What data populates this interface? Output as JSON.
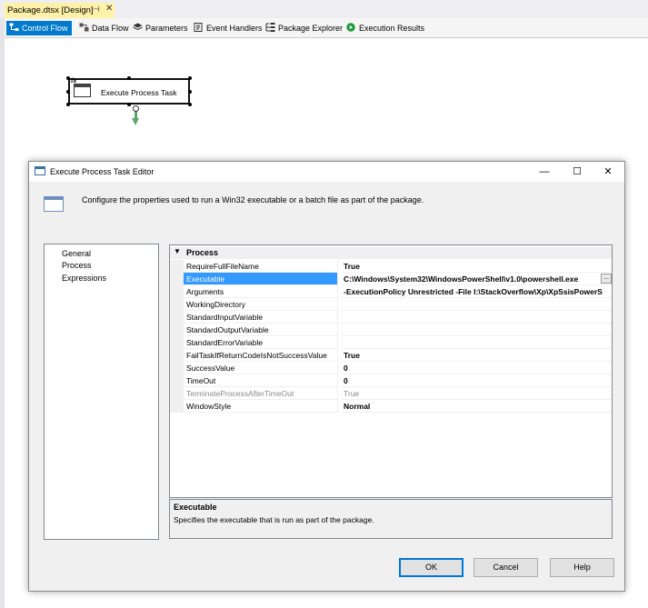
{
  "document_tab": {
    "title": "Package.dtsx [Design]",
    "pin_icon": "pin-icon",
    "close_glyph": "✕"
  },
  "designer_tabs": [
    {
      "label": "Control Flow",
      "icon": "control-flow-icon",
      "active": true
    },
    {
      "label": "Data Flow",
      "icon": "data-flow-icon"
    },
    {
      "label": "Parameters",
      "icon": "parameters-icon"
    },
    {
      "label": "Event Handlers",
      "icon": "event-handlers-icon"
    },
    {
      "label": "Package Explorer",
      "icon": "package-explorer-icon"
    },
    {
      "label": "Execution Results",
      "icon": "execution-results-icon"
    }
  ],
  "canvas": {
    "task": {
      "label": "Execute Process Task",
      "icon_text": "fx"
    }
  },
  "dialog": {
    "title": "Execute Process Task Editor",
    "window_buttons": {
      "minimize": "—",
      "maximize": "☐",
      "close": "✕"
    },
    "banner_text": "Configure the properties used to run a Win32 executable or a batch file as part of the package.",
    "nav": [
      "General",
      "Process",
      "Expressions"
    ],
    "category": "Process",
    "properties": [
      {
        "name": "RequireFullFileName",
        "value": "True"
      },
      {
        "name": "Executable",
        "value": "C:\\Windows\\System32\\WindowsPowerShell\\v1.0\\powershell.exe",
        "selected": true
      },
      {
        "name": "Arguments",
        "value": "-ExecutionPolicy Unrestricted -File I:\\StackOverflow\\Xp\\XpSsisPowerS"
      },
      {
        "name": "WorkingDirectory",
        "value": ""
      },
      {
        "name": "StandardInputVariable",
        "value": ""
      },
      {
        "name": "StandardOutputVariable",
        "value": ""
      },
      {
        "name": "StandardErrorVariable",
        "value": ""
      },
      {
        "name": "FailTaskIfReturnCodeIsNotSuccessValue",
        "value": "True"
      },
      {
        "name": "SuccessValue",
        "value": "0"
      },
      {
        "name": "TimeOut",
        "value": "0"
      },
      {
        "name": "TerminateProcessAfterTimeOut",
        "value": "True",
        "disabled": true
      },
      {
        "name": "WindowStyle",
        "value": "Normal"
      }
    ],
    "ellipsis": "...",
    "description": {
      "title": "Executable",
      "text": "Specifies the executable that is run as part of the package."
    },
    "buttons": {
      "ok": "OK",
      "cancel": "Cancel",
      "help": "Help"
    }
  },
  "colors": {
    "accent": "#007acc",
    "selection": "#3399ff",
    "tab_yellow": "#fff1a8",
    "connector": "#5aa76b"
  }
}
